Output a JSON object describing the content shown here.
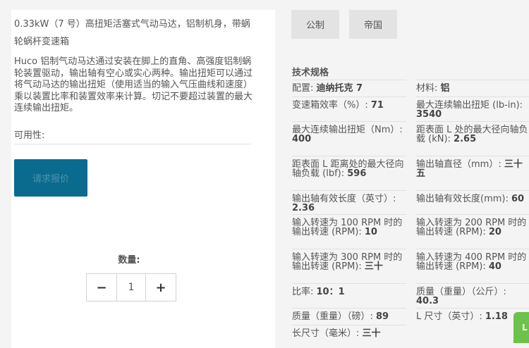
{
  "product": {
    "title": "0.33kW（7 号）高扭矩活塞式气动马达，铝制机身，带蜗轮蜗杆变速箱",
    "description": "Huco 铝制气动马达通过安装在脚上的直角、高强度铝制蜗轮装置驱动，输出轴有空心或实心两种。输出扭矩可以通过将气动马达的输出扭矩（使用适当的输入气压曲线和速度）乘以装置比率和装置效率来计算。切记不要超过装置的最大连续输出扭矩。",
    "availability_label": "可用性:",
    "quote_button": "请求报价",
    "quantity_label": "数量:",
    "quantity_value": "1",
    "minus": "−",
    "plus": "+"
  },
  "units": {
    "metric": "公制",
    "imperial": "帝国"
  },
  "specs": {
    "title": "技术规格",
    "items": [
      {
        "label": "配置: ",
        "value": "迪纳托克 7"
      },
      {
        "label": "材料: ",
        "value": "铝"
      },
      {
        "label": "变速箱效率（%）: ",
        "value": "71"
      },
      {
        "label": "最大连续输出扭矩 (lb-in): ",
        "value": "3540"
      },
      {
        "label": "最大连续输出扭矩（Nm）: ",
        "value": "400"
      },
      {
        "label": "距表面 L 处的最大径向轴负载 (kN): ",
        "value": "2.65"
      },
      {
        "label": "距表面 L 距离处的最大径向轴负载 (lbf): ",
        "value": "596"
      },
      {
        "label": "输出轴直径（mm）: ",
        "value": "三十五"
      },
      {
        "label": "输出轴有效长度（英寸）: ",
        "value": "2.36"
      },
      {
        "label": "输出轴有效长度(mm): ",
        "value": "60"
      },
      {
        "label": "输入转速为 100 RPM 时的输出转速 (RPM): ",
        "value": "10"
      },
      {
        "label": "输入转速为 200 RPM 时的输出转速 (RPM): ",
        "value": "20"
      },
      {
        "label": "输入转速为 300 RPM 时的输出转速 (RPM): ",
        "value": "三十"
      },
      {
        "label": "输入转速为 400 RPM 时的输出转速 (RPM): ",
        "value": "40"
      },
      {
        "label": "比率: ",
        "value": "10：1"
      },
      {
        "label": "质量（重量）（公斤）: ",
        "value": "40.3"
      },
      {
        "label": "质量（重量）（磅）: ",
        "value": "89"
      },
      {
        "label": "L 尺寸（英寸）: ",
        "value": "1.18"
      },
      {
        "label": "长尺寸（毫米）: ",
        "value": "三十"
      }
    ]
  },
  "chat": {
    "label": "L"
  },
  "colors": {
    "accent": "#0b6b8f",
    "chat": "#6cc24a"
  }
}
